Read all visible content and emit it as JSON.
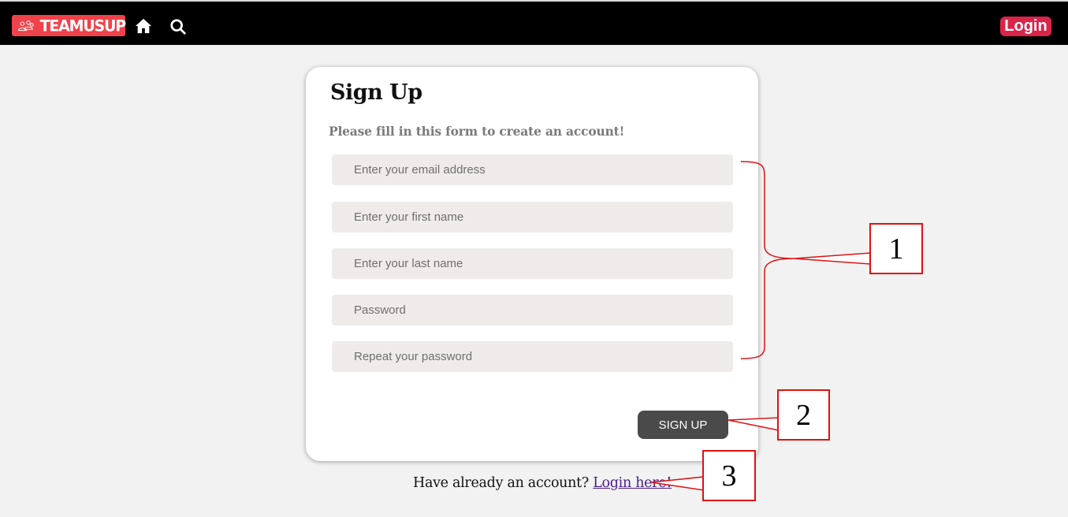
{
  "header": {
    "brand": "TEAMUSUP",
    "home_icon": "home-icon",
    "search_icon": "search-icon",
    "login_label": "Login",
    "brand_color": "#f0424a",
    "login_color": "#d9254a"
  },
  "form": {
    "title": "Sign Up",
    "subtitle": "Please fill in this form to create an account!",
    "fields": [
      {
        "placeholder": "Enter your email address"
      },
      {
        "placeholder": "Enter your first name"
      },
      {
        "placeholder": "Enter your last name"
      },
      {
        "placeholder": "Password"
      },
      {
        "placeholder": "Repeat your password"
      }
    ],
    "submit_label": "SIGN UP"
  },
  "footer": {
    "prompt": "Have already an account?",
    "link": "Login here!"
  },
  "annotations": {
    "callouts": [
      "1",
      "2",
      "3"
    ],
    "color": "#e01010"
  }
}
